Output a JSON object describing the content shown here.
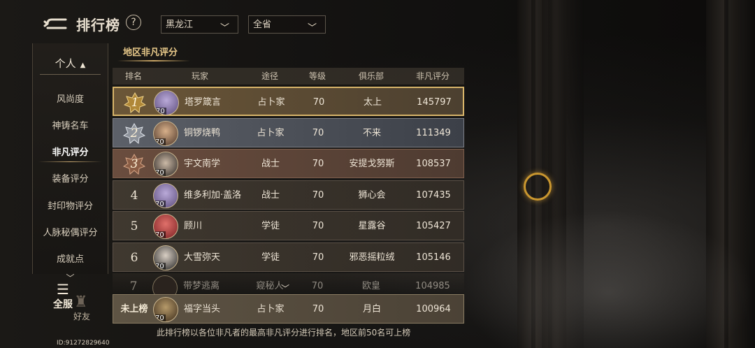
{
  "header": {
    "title": "排行榜",
    "help_label": "?",
    "region_select": "黑龙江",
    "scope_select": "全省"
  },
  "sidebar": {
    "section": "个人",
    "items": [
      "风尚度",
      "神铸名车",
      "非凡评分",
      "装备评分",
      "封印物评分",
      "人脉秘偶评分",
      "成就点"
    ],
    "active_index": 2,
    "all_server_label": "全服",
    "friends_label": "好友"
  },
  "tab": {
    "label": "地区非凡评分"
  },
  "table": {
    "columns": [
      "排名",
      "玩家",
      "途径",
      "等级",
      "俱乐部",
      "非凡评分"
    ],
    "rows": [
      {
        "rank": "1",
        "player": "塔罗箴言",
        "path": "占卜家",
        "level": "70",
        "club": "太上",
        "score": "145797",
        "avatar_level": "70"
      },
      {
        "rank": "2",
        "player": "铜锣烧鸭",
        "path": "占卜家",
        "level": "70",
        "club": "不来",
        "score": "111349",
        "avatar_level": "70"
      },
      {
        "rank": "3",
        "player": "宇文南学",
        "path": "战士",
        "level": "70",
        "club": "安提戈努斯",
        "score": "108537",
        "avatar_level": "70"
      },
      {
        "rank": "4",
        "player": "维多利加·盖洛",
        "path": "战士",
        "level": "70",
        "club": "狮心会",
        "score": "107435",
        "avatar_level": "70"
      },
      {
        "rank": "5",
        "player": "顾川",
        "path": "学徒",
        "level": "70",
        "club": "星露谷",
        "score": "105427",
        "avatar_level": "70"
      },
      {
        "rank": "6",
        "player": "大雪弥天",
        "path": "学徒",
        "level": "70",
        "club": "邪恶摇粒绒",
        "score": "105146",
        "avatar_level": "70"
      },
      {
        "rank": "7",
        "player": "带梦逃离",
        "path": "窥秘人",
        "level": "70",
        "club": "欧皇",
        "score": "104985",
        "avatar_level": ""
      }
    ],
    "my_row": {
      "rank": "未上榜",
      "player": "福字当头",
      "path": "占卜家",
      "level": "70",
      "club": "月白",
      "score": "100964",
      "avatar_level": "70"
    }
  },
  "footnote": "此排行榜以各位非凡者的最高非凡评分进行排名，地区前50名可上榜",
  "uid": "ID:91272829640",
  "colors": {
    "gold_border": "#d8b56a",
    "ring": "#c9962f",
    "tab_text": "#e8c98a"
  }
}
